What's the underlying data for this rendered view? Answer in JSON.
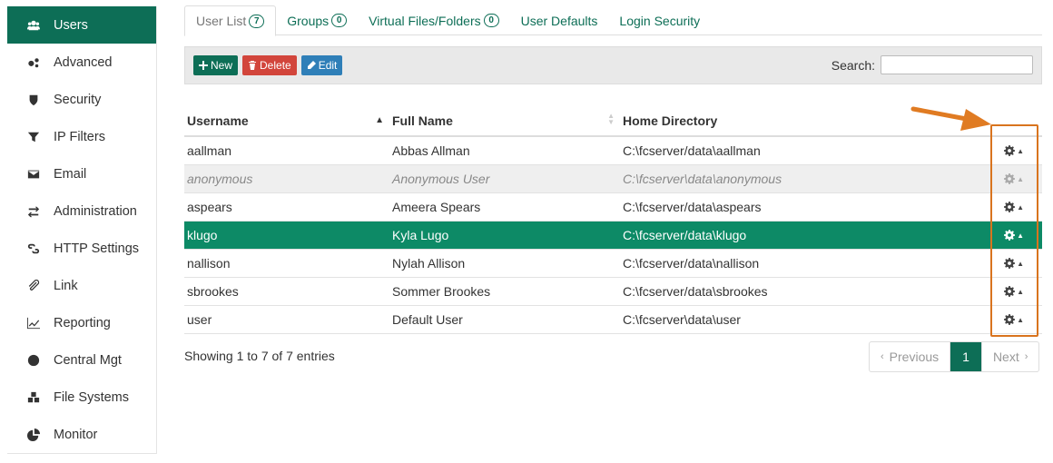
{
  "sidebar": {
    "items": [
      {
        "label": "Users",
        "icon": "users-icon"
      },
      {
        "label": "Advanced",
        "icon": "gears-icon"
      },
      {
        "label": "Security",
        "icon": "shield-icon"
      },
      {
        "label": "IP Filters",
        "icon": "filter-icon"
      },
      {
        "label": "Email",
        "icon": "envelope-icon"
      },
      {
        "label": "Administration",
        "icon": "exchange-icon"
      },
      {
        "label": "HTTP Settings",
        "icon": "link-icon"
      },
      {
        "label": "Link",
        "icon": "paperclip-icon"
      },
      {
        "label": "Reporting",
        "icon": "line-chart-icon"
      },
      {
        "label": "Central Mgt",
        "icon": "globe-icon"
      },
      {
        "label": "File Systems",
        "icon": "cubes-icon"
      },
      {
        "label": "Monitor",
        "icon": "pie-chart-icon"
      }
    ]
  },
  "tabs": [
    {
      "label": "User List",
      "badge": "7"
    },
    {
      "label": "Groups",
      "badge": "0"
    },
    {
      "label": "Virtual Files/Folders",
      "badge": "0"
    },
    {
      "label": "User Defaults",
      "badge": ""
    },
    {
      "label": "Login Security",
      "badge": ""
    }
  ],
  "toolbar": {
    "new_label": "New",
    "delete_label": "Delete",
    "edit_label": "Edit",
    "search_label": "Search:",
    "search_value": ""
  },
  "table": {
    "headers": [
      "Username",
      "Full Name",
      "Home Directory"
    ],
    "rows": [
      {
        "username": "aallman",
        "fullname": "Abbas Allman",
        "home": "C:\\fcserver/data\\aallman"
      },
      {
        "username": "anonymous",
        "fullname": "Anonymous User",
        "home": "C:\\fcserver\\data\\anonymous"
      },
      {
        "username": "aspears",
        "fullname": "Ameera Spears",
        "home": "C:\\fcserver/data\\aspears"
      },
      {
        "username": "klugo",
        "fullname": "Kyla Lugo",
        "home": "C:\\fcserver/data\\klugo"
      },
      {
        "username": "nallison",
        "fullname": "Nylah Allison",
        "home": "C:\\fcserver/data\\nallison"
      },
      {
        "username": "sbrookes",
        "fullname": "Sommer Brookes",
        "home": "C:\\fcserver/data\\sbrookes"
      },
      {
        "username": "user",
        "fullname": "Default User",
        "home": "C:\\fcserver\\data\\user"
      }
    ]
  },
  "footer": {
    "info": "Showing 1 to 7 of 7 entries",
    "prev_label": "Previous",
    "page": "1",
    "next_label": "Next"
  },
  "colors": {
    "accent": "#0d6e56",
    "selected_row": "#0d8a66",
    "danger": "#d2453b",
    "info": "#2f7fb8",
    "highlight": "#d9741e"
  }
}
